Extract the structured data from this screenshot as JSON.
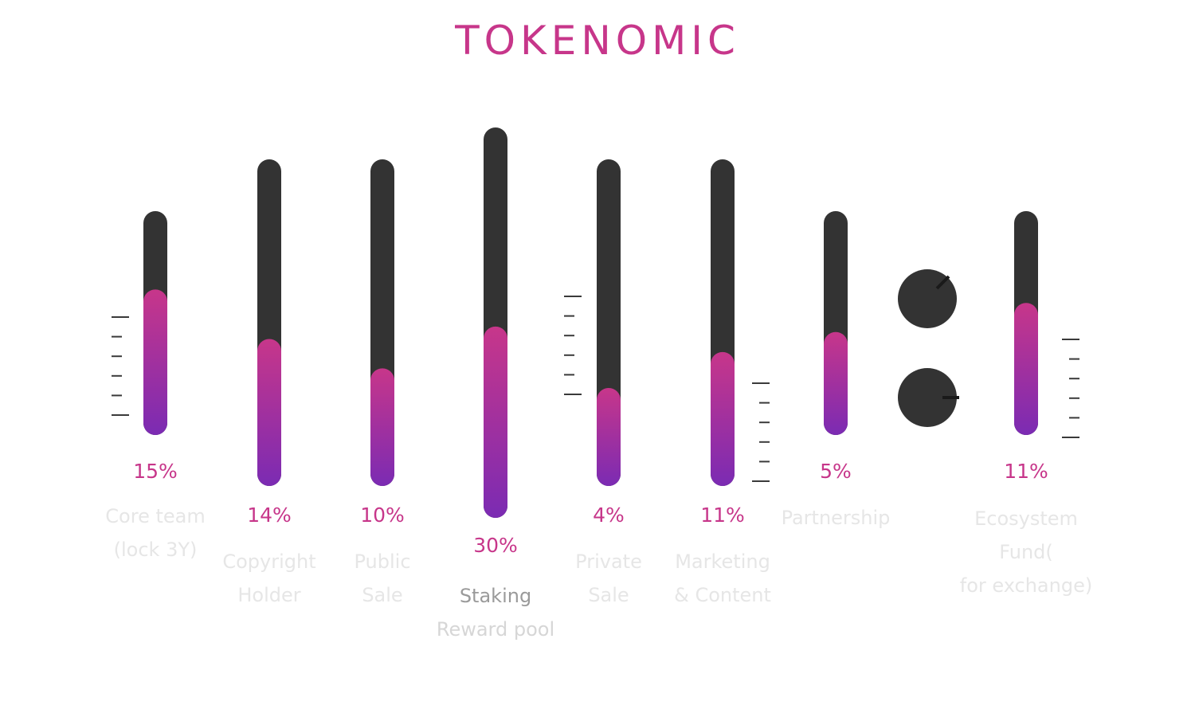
{
  "title": "TOKENOMIC",
  "colors": {
    "accent": "#c7368a",
    "gradient_top": "#c7368a",
    "gradient_bottom": "#7b2bb3",
    "track": "#333333",
    "label_light": "#e6e6e6",
    "label_mid": "#d6d6d6",
    "label_dark": "#9a9a9a",
    "tick": "#3a3a3a"
  },
  "chart_data": {
    "type": "bar",
    "title": "TOKENOMIC",
    "categories": [
      "Core team (lock 3Y)",
      "Copyright Holder",
      "Public Sale",
      "Staking Reward pool",
      "Private Sale",
      "Marketing & Content",
      "Partnership",
      "Ecosystem Fund( for exchange)"
    ],
    "values": [
      15,
      14,
      10,
      30,
      4,
      11,
      5,
      11
    ],
    "unit": "%",
    "value_labels": [
      "15%",
      "14%",
      "10%",
      "30%",
      "4%",
      "11%",
      "5%",
      "11%"
    ],
    "label_lines": [
      [
        "Core team",
        "(lock 3Y)"
      ],
      [
        "Copyright",
        "Holder"
      ],
      [
        "Public",
        "Sale"
      ],
      [
        "Staking",
        "Reward pool"
      ],
      [
        "Private",
        "Sale"
      ],
      [
        "Marketing",
        "& Content"
      ],
      [
        "Partnership"
      ],
      [
        "Ecosystem",
        "Fund(",
        "for exchange)"
      ]
    ],
    "level_fill_fraction": [
      0.65,
      0.45,
      0.36,
      0.49,
      0.3,
      0.41,
      0.46,
      0.59
    ],
    "legend": "none",
    "grid": false
  },
  "decor_icons": [
    "knob-icon",
    "knob-icon"
  ]
}
